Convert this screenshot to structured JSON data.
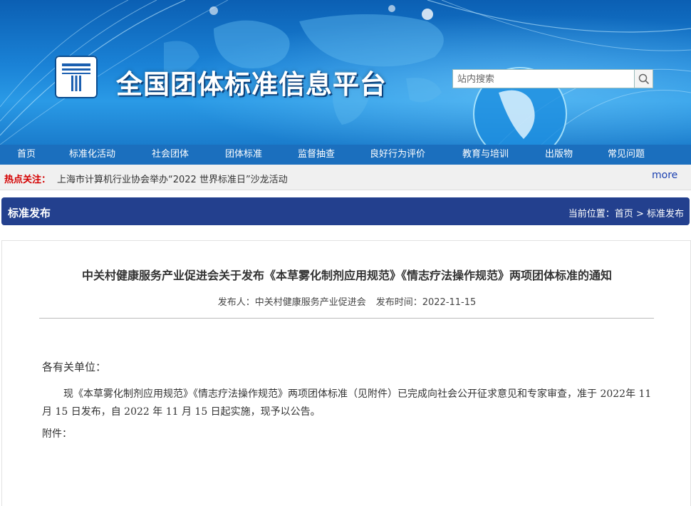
{
  "header": {
    "site_title": "全国团体标准信息平台",
    "search_placeholder": "站内搜索"
  },
  "nav": {
    "items": [
      {
        "label": "首页"
      },
      {
        "label": "标准化活动"
      },
      {
        "label": "社会团体"
      },
      {
        "label": "团体标准"
      },
      {
        "label": "监督抽查"
      },
      {
        "label": "良好行为评价"
      },
      {
        "label": "教育与培训"
      },
      {
        "label": "出版物"
      },
      {
        "label": "常见问题"
      }
    ]
  },
  "hot": {
    "label": "热点关注：",
    "text": "上海市计算机行业协会举办“2022 世界标准日”沙龙活动",
    "more": "more"
  },
  "section": {
    "title": "标准发布",
    "crumb_prefix": "当前位置：",
    "crumb_home": "首页",
    "crumb_sep": " > ",
    "crumb_current": "标准发布"
  },
  "article": {
    "title": "中关村健康服务产业促进会关于发布《本草雾化制剂应用规范》《情志疗法操作规范》两项团体标准的通知",
    "publisher_label": "发布人：",
    "publisher": "中关村健康服务产业促进会",
    "time_label": "发布时间：",
    "time": "2022-11-15",
    "salutation": "各有关单位：",
    "body": "现《本草雾化制剂应用规范》《情志疗法操作规范》两项团体标准（见附件）已完成向社会公开征求意见和专家审查，准于  2022年  11 月  15 日发布，自  2022 年  11 月  15 日起实施，现予以公告。",
    "attachment": "附件："
  },
  "colors": {
    "nav_bg": "#1b6fbe",
    "section_bg": "#23408e",
    "hot_label": "#d40000",
    "more_link": "#1a3fb0"
  }
}
